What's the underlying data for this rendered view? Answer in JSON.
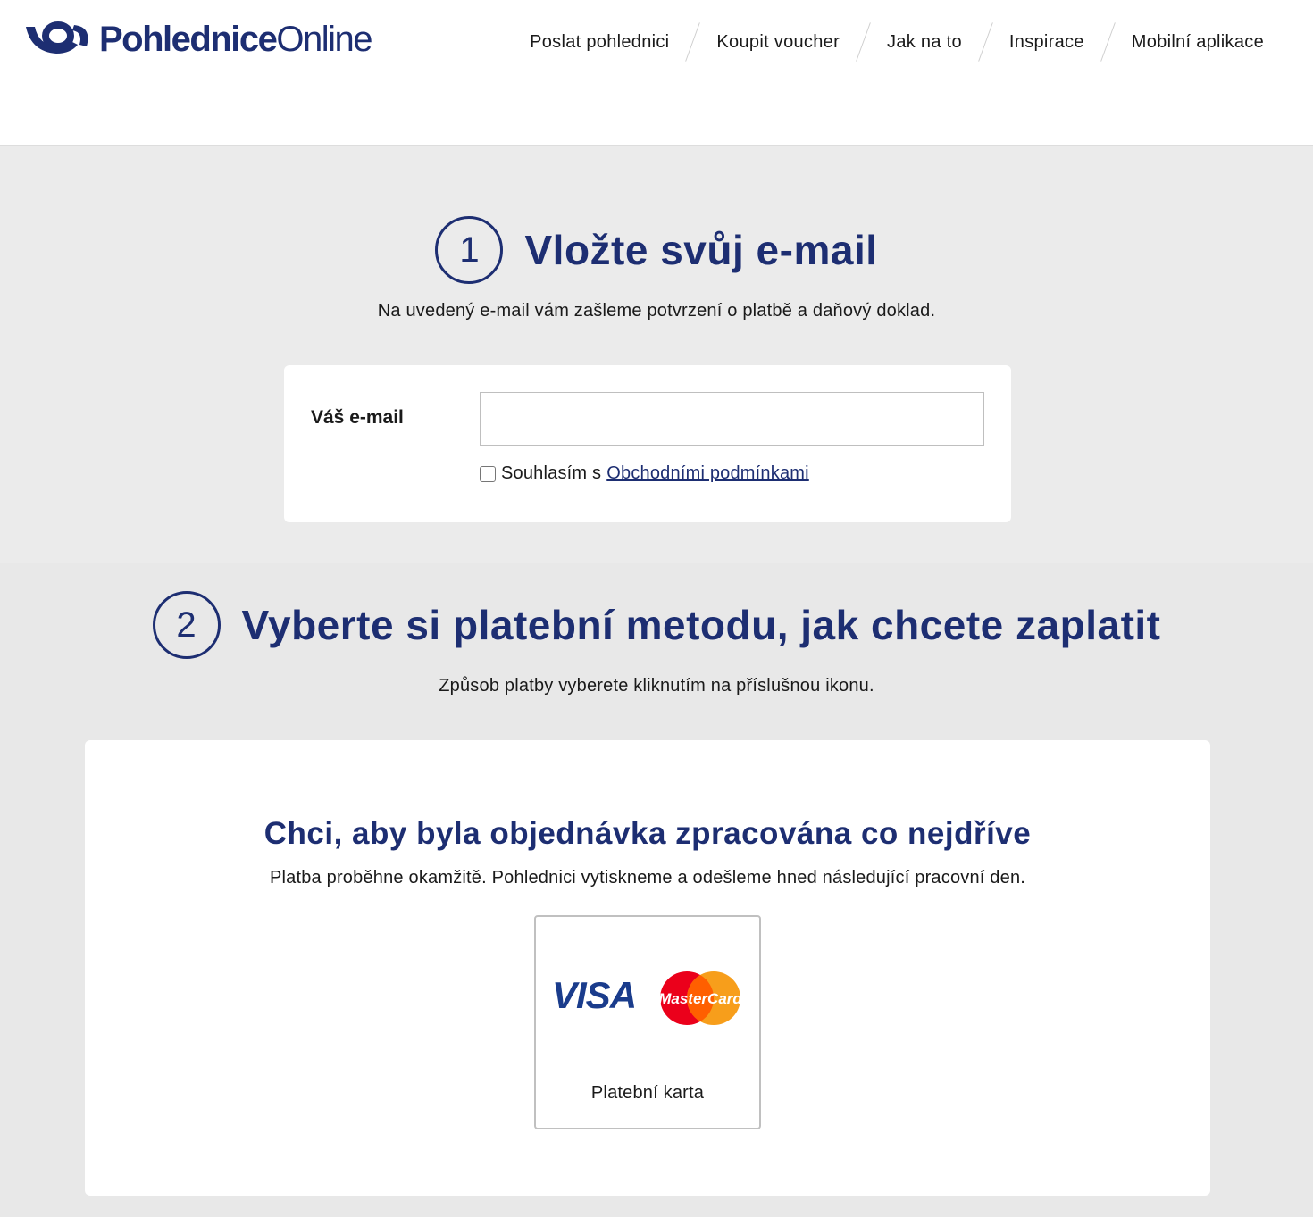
{
  "header": {
    "logo": {
      "bold": "Pohlednice",
      "light": "Online"
    },
    "nav": [
      {
        "label": "Poslat pohlednici"
      },
      {
        "label": "Koupit voucher"
      },
      {
        "label": "Jak na to"
      },
      {
        "label": "Inspirace"
      },
      {
        "label": "Mobilní aplikace"
      }
    ]
  },
  "step1": {
    "number": "1",
    "title": "Vložte svůj e-mail",
    "subtitle": "Na uvedený e-mail vám zašleme potvrzení o platbě a daňový doklad.",
    "email_label": "Váš e-mail",
    "email_value": "",
    "terms_text": "Souhlasím s",
    "terms_link": "Obchodními podmínkami",
    "terms_checked": false
  },
  "step2": {
    "number": "2",
    "title": "Vyberte si platební metodu, jak chcete zaplatit",
    "subtitle": "Způsob platby vyberete kliknutím na příslušnou ikonu.",
    "card": {
      "title": "Chci, aby byla objednávka zpracována co nejdříve",
      "subtitle": "Platba proběhne okamžitě. Pohlednici vytiskneme a odešleme hned následující pracovní den.",
      "option": {
        "visa_text": "VISA",
        "mastercard_text": "MasterCard",
        "label": "Platební karta"
      }
    }
  },
  "colors": {
    "brand_navy": "#1d2e72",
    "page_bg": "#ebebeb",
    "mastercard_red": "#eb001b",
    "mastercard_yellow": "#f79e1b"
  },
  "icons": {
    "logo": "post-horn-icon",
    "checkbox": "checkbox-icon"
  }
}
